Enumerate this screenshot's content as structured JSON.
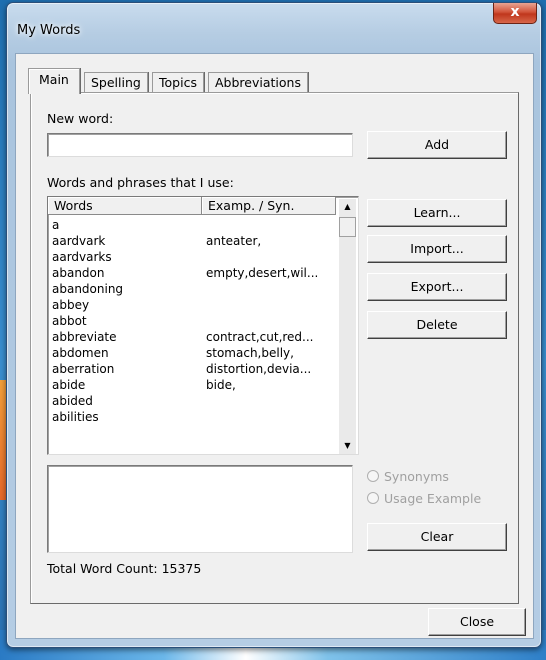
{
  "window": {
    "title": "My Words",
    "close_glyph": "x"
  },
  "tabs": [
    "Main",
    "Spelling",
    "Topics",
    "Abbreviations"
  ],
  "main": {
    "new_word_label": "New word:",
    "new_word_value": "",
    "add_label": "Add",
    "list_label": "Words and phrases that I use:",
    "columns": [
      "Words",
      "Examp. / Syn."
    ],
    "rows": [
      {
        "word": "a",
        "ex": ""
      },
      {
        "word": "aardvark",
        "ex": "anteater,"
      },
      {
        "word": "aardvarks",
        "ex": ""
      },
      {
        "word": "abandon",
        "ex": "empty,desert,wil..."
      },
      {
        "word": "abandoning",
        "ex": ""
      },
      {
        "word": "abbey",
        "ex": ""
      },
      {
        "word": "abbot",
        "ex": ""
      },
      {
        "word": "abbreviate",
        "ex": "contract,cut,red..."
      },
      {
        "word": "abdomen",
        "ex": "stomach,belly,"
      },
      {
        "word": "aberration",
        "ex": "distortion,devia..."
      },
      {
        "word": "abide",
        "ex": "bide,"
      },
      {
        "word": "abided",
        "ex": ""
      },
      {
        "word": "abilities",
        "ex": ""
      }
    ],
    "buttons": {
      "learn": "Learn...",
      "import": "Import...",
      "export": "Export...",
      "delete": "Delete",
      "clear": "Clear"
    },
    "radio_synonyms": "Synonyms",
    "radio_usage": "Usage Example",
    "total_label": "Total Word Count: 15375"
  },
  "close_label": "Close"
}
